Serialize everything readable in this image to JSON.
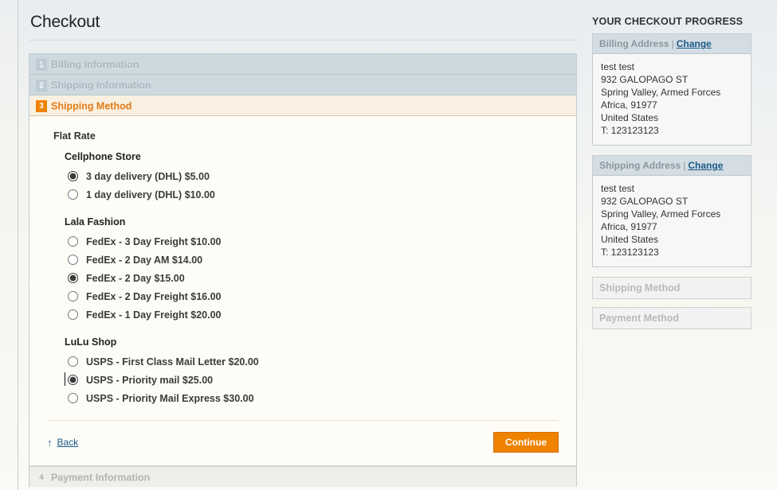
{
  "page": {
    "title": "Checkout"
  },
  "steps": [
    {
      "number": "1",
      "label": "Billing Information",
      "state": "done"
    },
    {
      "number": "2",
      "label": "Shipping Information",
      "state": "done"
    },
    {
      "number": "3",
      "label": "Shipping Method",
      "state": "active"
    },
    {
      "number": "4",
      "label": "Payment Information",
      "state": "upcoming"
    }
  ],
  "shipping": {
    "method_title": "Flat Rate",
    "carriers": [
      {
        "name": "Cellphone Store",
        "options": [
          {
            "label": "3 day delivery (DHL) $5.00",
            "selected": true,
            "focused": false
          },
          {
            "label": "1 day delivery (DHL) $10.00",
            "selected": false,
            "focused": false
          }
        ]
      },
      {
        "name": "Lala Fashion",
        "options": [
          {
            "label": "FedEx - 3 Day Freight $10.00",
            "selected": false,
            "focused": false
          },
          {
            "label": "FedEx - 2 Day AM $14.00",
            "selected": false,
            "focused": false
          },
          {
            "label": "FedEx - 2 Day $15.00",
            "selected": true,
            "focused": false
          },
          {
            "label": "FedEx - 2 Day Freight $16.00",
            "selected": false,
            "focused": false
          },
          {
            "label": "FedEx - 1 Day Freight $20.00",
            "selected": false,
            "focused": false
          }
        ]
      },
      {
        "name": "LuLu Shop",
        "options": [
          {
            "label": "USPS - First Class Mail Letter $20.00",
            "selected": false,
            "focused": false
          },
          {
            "label": "USPS - Priority mail $25.00",
            "selected": true,
            "focused": true
          },
          {
            "label": "USPS - Priority Mail Express $30.00",
            "selected": false,
            "focused": false
          }
        ]
      }
    ],
    "back_label": "Back",
    "back_arrow": "↑",
    "continue_label": "Continue"
  },
  "sidebar": {
    "title": "YOUR CHECKOUT PROGRESS",
    "blocks": [
      {
        "heading": "Billing Address",
        "separator": "|",
        "change_label": "Change",
        "lines": [
          "test test",
          "932 GALOPAGO ST",
          "Spring Valley, Armed Forces",
          "Africa, 91977",
          "United States",
          "T: 123123123"
        ]
      },
      {
        "heading": "Shipping Address",
        "separator": "|",
        "change_label": "Change",
        "lines": [
          "test test",
          "932 GALOPAGO ST",
          "Spring Valley, Armed Forces",
          "Africa, 91977",
          "United States",
          "T: 123123123"
        ]
      }
    ],
    "muted_blocks": [
      {
        "heading": "Shipping Method"
      },
      {
        "heading": "Payment Method"
      }
    ]
  },
  "colors": {
    "accent_orange": "#ef8200",
    "step_done_bg": "#cdd9df",
    "step_active_bg": "#faf0e1",
    "link_blue": "#1a5a8a",
    "sidebar_head_bg": "#d3dde3"
  }
}
